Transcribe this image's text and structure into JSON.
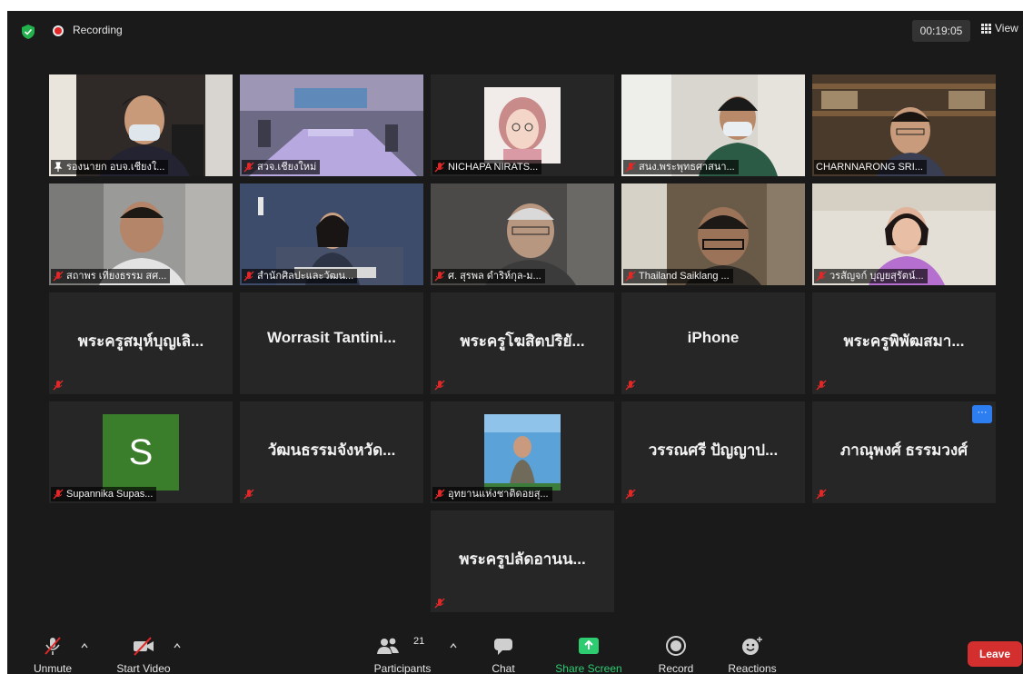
{
  "topbar": {
    "recording_label": "Recording",
    "timer": "00:19:05",
    "view_label": "View"
  },
  "tiles": {
    "t1": {
      "name": "รองนายก อบจ.เชียงใ..."
    },
    "t2": {
      "name": "สวจ.เชียงใหม่"
    },
    "t3": {
      "name": "NICHAPA NIRATS..."
    },
    "t4": {
      "name": "สนง.พระพุทธศาสนา..."
    },
    "t5": {
      "name": "CHARNNARONG SRI..."
    },
    "t6": {
      "name": "สถาพร เที่ยงธรรม สศ..."
    },
    "t7": {
      "name": "สำนักศิลปะและวัฒน..."
    },
    "t8": {
      "name": "ศ. สุรพล ดำริห์กุล-ม..."
    },
    "t9": {
      "name": "Thailand Saiklang ..."
    },
    "t10": {
      "name": "วรสัญจก์ บุญยสุรัตน์..."
    },
    "t11": {
      "name": "พระครูสมุห์บุญเลิ..."
    },
    "t12": {
      "name": "Worrasit  Tantini..."
    },
    "t13": {
      "name": "พระครูโฆสิตปริยั..."
    },
    "t14": {
      "name": "iPhone"
    },
    "t15": {
      "name": "พระครูพิพัฒสมา..."
    },
    "t16": {
      "name": "Supannika Supas...",
      "initial": "S"
    },
    "t17": {
      "name": "วัฒนธรรมจังหวัด..."
    },
    "t18": {
      "name": "อุทยานแห่งชาติดอยสุ..."
    },
    "t19": {
      "name": "วรรณศรี ปัญญาป..."
    },
    "t20": {
      "name": "ภาณุพงศ์ ธรรมวงศ์"
    },
    "t21": {
      "name": "พระครูปลัดอานน..."
    }
  },
  "toolbar": {
    "unmute": "Unmute",
    "start_video": "Start Video",
    "participants": "Participants",
    "participants_count": "21",
    "chat": "Chat",
    "share_screen": "Share Screen",
    "record": "Record",
    "reactions": "Reactions",
    "leave": "Leave"
  },
  "colors": {
    "background": "#1a1a1a",
    "tile": "#262626",
    "active_border": "#c6e05a",
    "share_green": "#2ecc71",
    "leave_red": "#d32f2f",
    "mic_off_red": "#e02828"
  }
}
